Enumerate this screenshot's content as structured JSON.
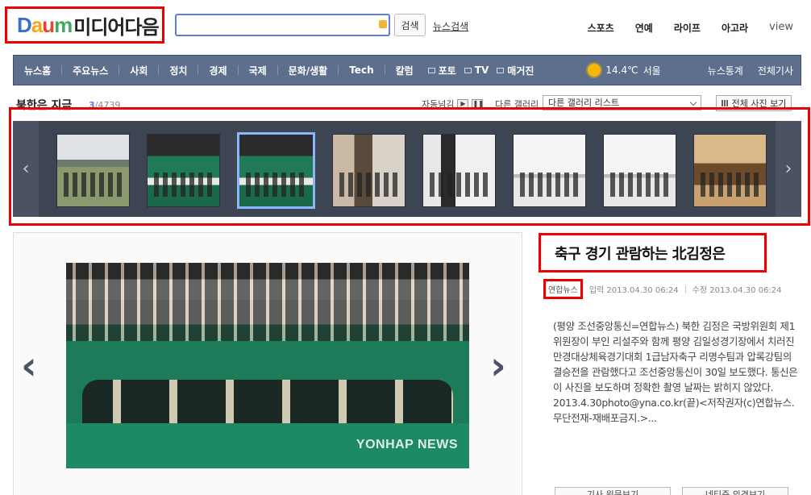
{
  "header": {
    "logo_brand": "Daum",
    "logo_text": "미디어다음",
    "search": {
      "value": "",
      "placeholder": "",
      "button_label": "검색"
    },
    "news_search_link": "뉴스검색",
    "top_nav": [
      "스포츠",
      "연예",
      "라이프",
      "아고라",
      "view"
    ]
  },
  "navbar": {
    "items": [
      "뉴스홈",
      "주요뉴스",
      "사회",
      "정치",
      "경제",
      "국제",
      "문화/생활",
      "Tech",
      "칼럼"
    ],
    "media": [
      "포토",
      "TV",
      "매거진"
    ],
    "weather": {
      "temp": "14.4℃",
      "city": "서울",
      "icon": "sun-icon"
    },
    "right_links": [
      "뉴스통계",
      "전체기사"
    ],
    "colors": {
      "bar": "#5e6f8e",
      "accent_red": "#e00000"
    }
  },
  "gallery": {
    "title": "북한은 지금",
    "count_current": "3",
    "count_total": "/4739",
    "autoplay_label": "자동넘김",
    "other_gallery_label": "다른 갤러리",
    "select_value": "다른 갤러리 리스트",
    "all_photos_label": "전체 사진 보기",
    "thumbnails": [
      {
        "alt": "stadium"
      },
      {
        "alt": "stands"
      },
      {
        "alt": "stands-active",
        "active": true
      },
      {
        "alt": "room"
      },
      {
        "alt": "shop"
      },
      {
        "alt": "shop2"
      },
      {
        "alt": "shop3"
      },
      {
        "alt": "warm-room"
      }
    ]
  },
  "article": {
    "headline": "축구 경기 관람하는 北김정은",
    "source": "연합뉴스",
    "input_time": "입력 2013.04.30 06:24",
    "edit_time": "수정 2013.04.30 06:24",
    "body": "(평양 조선중앙통신=연합뉴스) 북한 김정은 국방위원회 제1위원장이 부인 리설주와 함께 평양 김일성경기장에서 치러진 만경대상체육경기대회 1급남자축구 리명수팀과 압록강팀의 결승전을 관람했다고 조선중앙통신이 30일 보도했다. 통신은 이 사진을 보도하며 정확한 촬영 날짜는 밝히지 않았다. 2013.4.30photo@yna.co.kr(끝)<저작권자(c)연합뉴스. 무단전재-재배포금지.>...",
    "photo_watermark": "YONHAP NEWS",
    "bottom_buttons": [
      "기사 원문보기",
      "네티즌 의견보기"
    ]
  }
}
